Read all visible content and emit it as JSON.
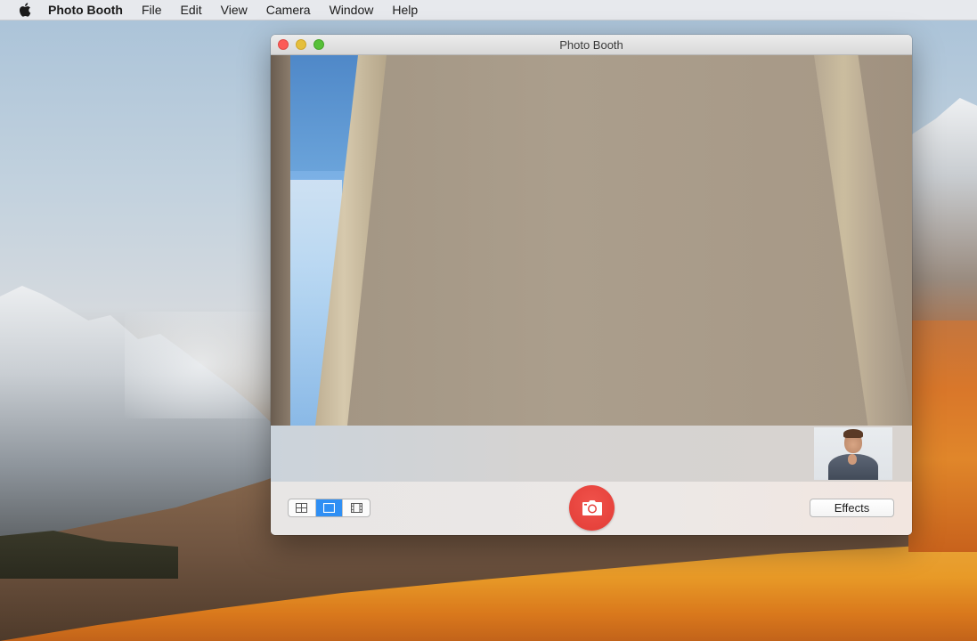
{
  "menubar": {
    "app_name": "Photo Booth",
    "items": [
      "File",
      "Edit",
      "View",
      "Camera",
      "Window",
      "Help"
    ]
  },
  "window": {
    "title": "Photo Booth"
  },
  "toolbar": {
    "view_modes": [
      {
        "name": "four-up",
        "icon": "grid-icon",
        "selected": false
      },
      {
        "name": "single",
        "icon": "single-photo-icon",
        "selected": true
      },
      {
        "name": "movie",
        "icon": "film-icon",
        "selected": false
      }
    ],
    "shutter_icon": "camera-icon",
    "effects_label": "Effects"
  },
  "colors": {
    "shutter": "#e8413b",
    "selected_segment": "#2f8ff4",
    "close": "#fc5b57",
    "minimize": "#e5bf3c",
    "zoom": "#57c038"
  }
}
